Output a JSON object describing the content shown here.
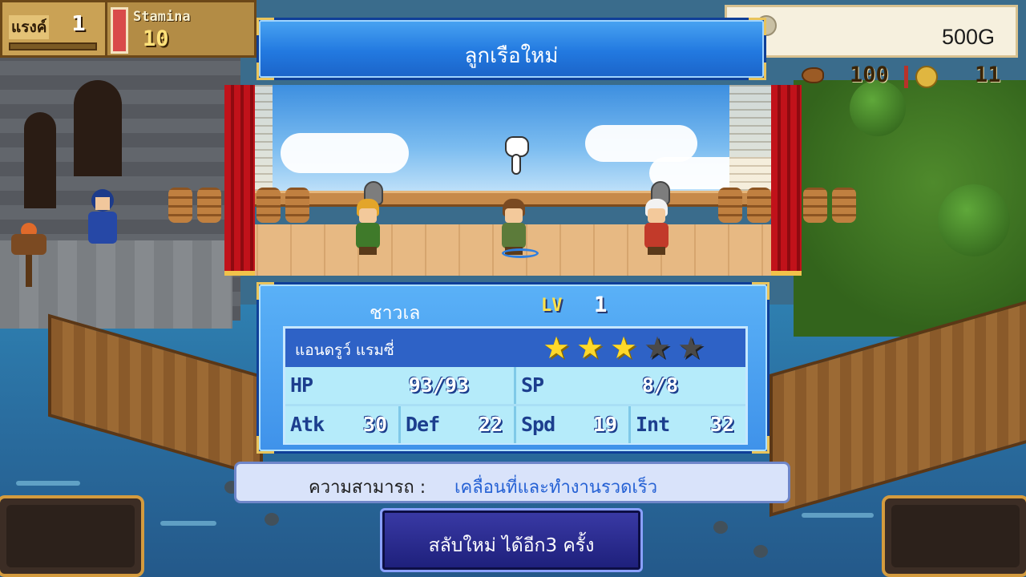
{
  "hud": {
    "rank_label": "แรงค์",
    "rank_value": "1",
    "stamina_label": "Stamina",
    "stamina_value": "10",
    "gold": "500G",
    "food": "100",
    "coins": "11"
  },
  "dialog": {
    "title": "ลูกเรือใหม่",
    "crew": {
      "job": "ชาวเล",
      "level_label": "LV",
      "level": "1",
      "name": "แอนดรูว์ แรมซี่",
      "stars": 3,
      "stars_max": 5,
      "stats": {
        "hp_label": "HP",
        "hp": "93/93",
        "sp_label": "SP",
        "sp": "8/8",
        "atk_label": "Atk",
        "atk": "30",
        "def_label": "Def",
        "def": "22",
        "spd_label": "Spd",
        "spd": "19",
        "int_label": "Int",
        "int": "32"
      }
    },
    "ability_label": "ความสามารถ :",
    "ability_value": "เคลื่อนที่และทำงานรวดเร็ว",
    "reroll_button": "สลับใหม่  ได้อีก3 ครั้ง"
  },
  "colors": {
    "banner_blue": "#2279e0",
    "star_on": "#ffd92a",
    "star_off": "#4a4a4a",
    "ability_text": "#2561d4"
  }
}
